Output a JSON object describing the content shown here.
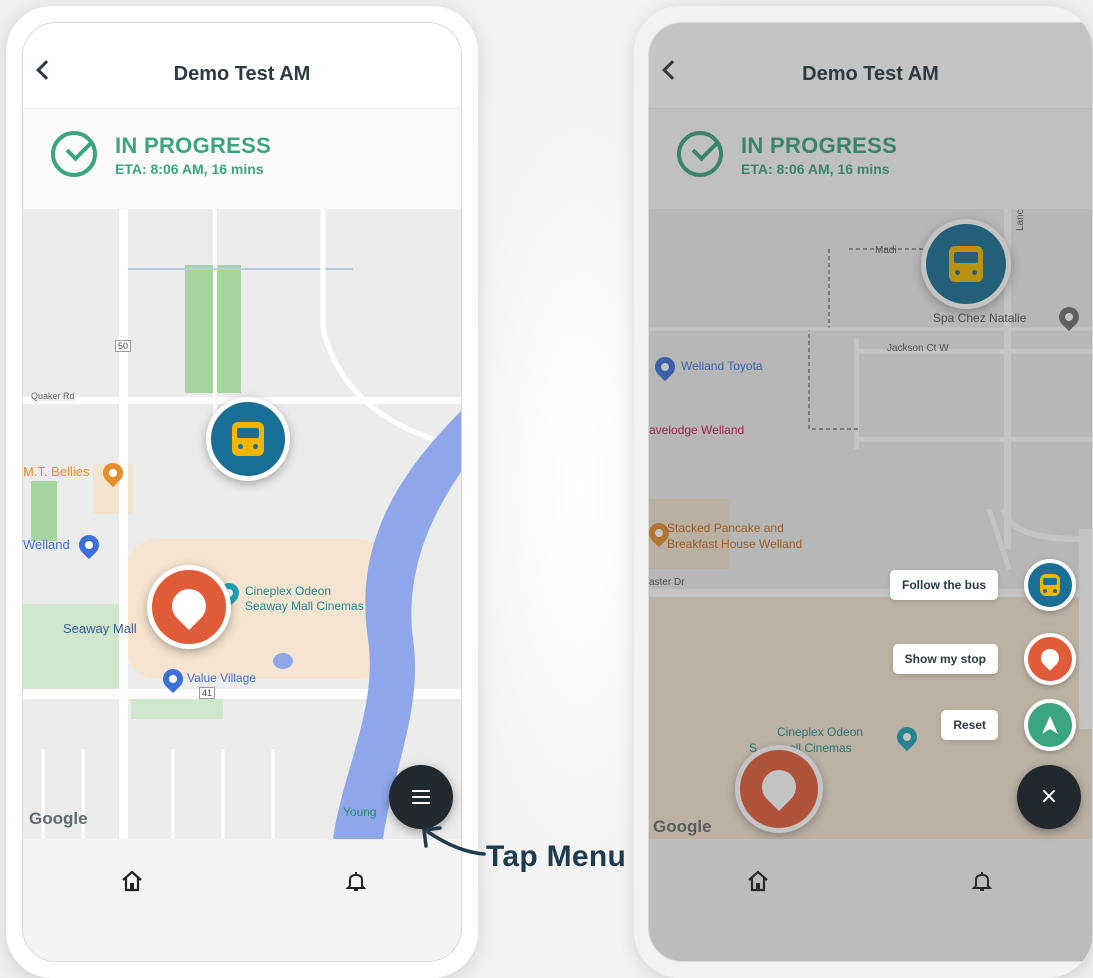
{
  "left_screen": {
    "header": {
      "title": "Demo Test AM"
    },
    "status": {
      "label": "IN PROGRESS",
      "eta": "ETA: 8:06 AM, 16 mins"
    },
    "map": {
      "labels": {
        "quaker_rd": "Quaker Rd",
        "route_50": "50",
        "route_41": "41",
        "mt_bellies": "M.T. Bellies",
        "welland": "Welland",
        "seaway_mall": "Seaway Mall",
        "cineplex_line1": "Cineplex Odeon",
        "cineplex_line2": "Seaway Mall Cinemas",
        "value_village": "Value Village",
        "young": "Young"
      },
      "attribution": "Google"
    },
    "icons": {
      "bus_marker": "bus-icon",
      "stop_marker": "location-pin-icon",
      "fab": "menu-icon",
      "home": "home-icon",
      "bell": "bell-icon"
    }
  },
  "annotation": {
    "text": "Tap Menu"
  },
  "right_screen": {
    "header": {
      "title": "Demo Test AM"
    },
    "status": {
      "label": "IN PROGRESS",
      "eta": "ETA: 8:06 AM, 16 mins"
    },
    "map": {
      "labels": {
        "madi": "Madi",
        "lancaster": "Lancaste",
        "spa": "Spa Chez Natalie",
        "jackson": "Jackson Ct W",
        "welland_toyota": "Welland Toyota",
        "travelodge": "avelodge Welland",
        "stacked_line1": "Stacked Pancake and",
        "stacked_line2": "Breakfast House Welland",
        "aster_dr": "aster Dr",
        "cineplex_line1": "Cineplex Odeon",
        "cineplex_line2": "all Cinemas",
        "s_letter": "S"
      },
      "attribution": "Google"
    },
    "menu": {
      "items": [
        {
          "label": "Follow the bus",
          "icon": "bus-icon",
          "color": "#1a6f96"
        },
        {
          "label": "Show my stop",
          "icon": "location-pin-icon",
          "color": "#e05c38"
        },
        {
          "label": "Reset",
          "icon": "navigation-arrow-icon",
          "color": "#3aa57f"
        }
      ],
      "close_icon": "close-icon"
    }
  },
  "colors": {
    "accent_green": "#3aa57f",
    "bus_blue": "#1a6f96",
    "stop_orange": "#e05c38",
    "dark": "#2b3a42",
    "river": "#8fa7ea"
  }
}
